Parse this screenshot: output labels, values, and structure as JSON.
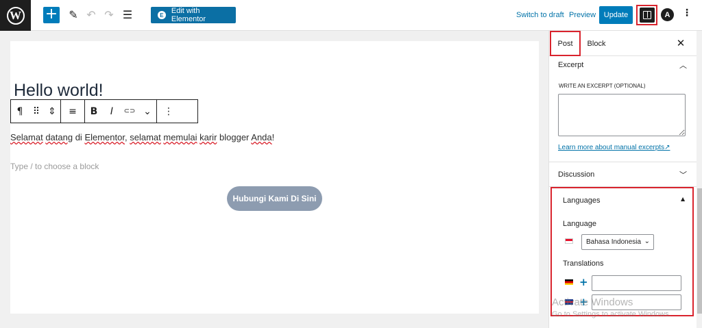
{
  "topbar": {
    "logo_glyph": "W",
    "add_glyph": "+",
    "tools_glyph": "✎",
    "undo_glyph": "↶",
    "redo_glyph": "↷",
    "outline_glyph": "☰",
    "elementor_label": "Edit with Elementor",
    "elementor_glyph": "E",
    "switch_draft_label": "Switch to draft",
    "preview_label": "Preview",
    "update_label": "Update",
    "astra_glyph": "A",
    "more_glyph": "⋮"
  },
  "editor": {
    "title": "Hello world!",
    "paragraph": [
      {
        "text": "Selamat",
        "spell": true
      },
      {
        "text": " ",
        "spell": false
      },
      {
        "text": "datang",
        "spell": true
      },
      {
        "text": " di ",
        "spell": false
      },
      {
        "text": "Elementor",
        "spell": true
      },
      {
        "text": ", ",
        "spell": false
      },
      {
        "text": "selamat",
        "spell": true
      },
      {
        "text": " ",
        "spell": false
      },
      {
        "text": "memulai",
        "spell": true
      },
      {
        "text": " ",
        "spell": false
      },
      {
        "text": "karir",
        "spell": true
      },
      {
        "text": " blogger ",
        "spell": false
      },
      {
        "text": "Anda",
        "spell": true
      },
      {
        "text": "!",
        "spell": false
      }
    ],
    "placeholder": "Type / to choose a block",
    "cta_button": "Hubungi Kami Di Sini",
    "toolbar": {
      "paragraph_glyph": "¶",
      "drag_glyph": "⠿",
      "mover_glyph": "⇕",
      "align_glyph": "≡",
      "bold_glyph": "B",
      "italic_glyph": "I",
      "link_glyph": "⊂⊃",
      "more_rich_glyph": "⌄",
      "options_glyph": "⋮"
    }
  },
  "sidebar": {
    "tab_post": "Post",
    "tab_block": "Block",
    "close_glyph": "✕",
    "excerpt": {
      "title": "Excerpt",
      "label": "WRITE AN EXCERPT (OPTIONAL)",
      "value": "",
      "link": "Learn more about manual excerpts↗"
    },
    "discussion_title": "Discussion",
    "languages": {
      "title": "Languages",
      "language_label": "Language",
      "selected": "Bahasa Indonesia",
      "translations_label": "Translations"
    }
  },
  "watermark": {
    "line1": "Activate Windows",
    "line2": "Go to Settings to activate Windows."
  },
  "colors": {
    "accent": "#007cba",
    "highlight": "#d9232d"
  }
}
